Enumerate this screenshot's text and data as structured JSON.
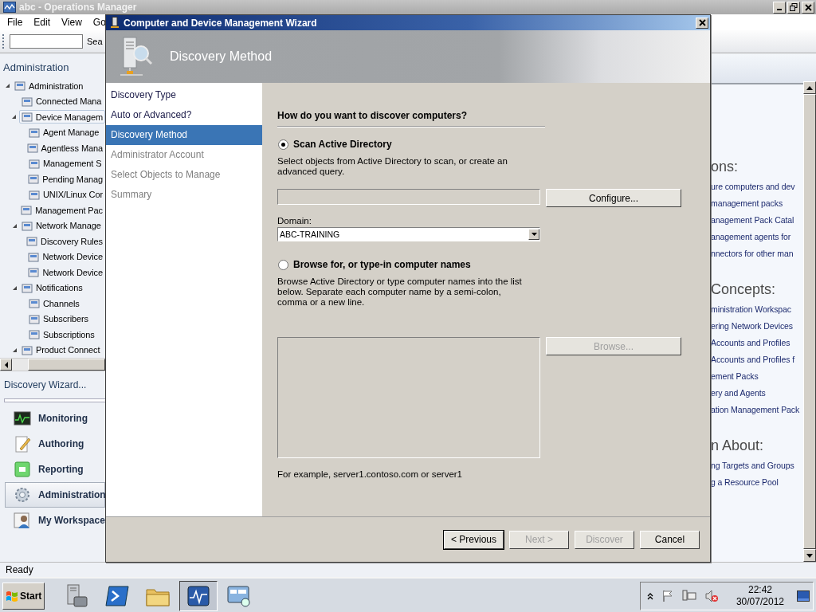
{
  "main_window": {
    "title": "abc - Operations Manager",
    "menu": [
      "File",
      "Edit",
      "View",
      "Go"
    ],
    "search_button": "Sea"
  },
  "navigation": {
    "heading": "Administration",
    "tree": [
      {
        "label": "Administration",
        "selected": false,
        "expanded": true,
        "children": [
          {
            "label": "Connected Mana",
            "selected": false
          },
          {
            "label": "Device Managem",
            "selected": true,
            "expanded": true,
            "children": [
              {
                "label": "Agent Manage",
                "selected": false
              },
              {
                "label": "Agentless Mana",
                "selected": false
              },
              {
                "label": "Management S",
                "selected": false
              },
              {
                "label": "Pending Manag",
                "selected": false
              },
              {
                "label": "UNIX/Linux Cor",
                "selected": false
              }
            ]
          },
          {
            "label": "Management Pac",
            "selected": false
          },
          {
            "label": "Network Manage",
            "selected": false,
            "expanded": true,
            "children": [
              {
                "label": "Discovery Rules",
                "selected": false
              },
              {
                "label": "Network Device",
                "selected": false
              },
              {
                "label": "Network Device",
                "selected": false
              }
            ]
          },
          {
            "label": "Notifications",
            "selected": false,
            "expanded": true,
            "children": [
              {
                "label": "Channels",
                "selected": false
              },
              {
                "label": "Subscribers",
                "selected": false
              },
              {
                "label": "Subscriptions",
                "selected": false
              }
            ]
          },
          {
            "label": "Product Connect",
            "selected": false,
            "expanded": true
          }
        ]
      }
    ],
    "tasks": [
      "Discovery Wizard..."
    ],
    "workspaces": [
      {
        "label": "Monitoring",
        "selected": false
      },
      {
        "label": "Authoring",
        "selected": false
      },
      {
        "label": "Reporting",
        "selected": false
      },
      {
        "label": "Administration",
        "selected": true
      },
      {
        "label": "My Workspace",
        "selected": false
      }
    ]
  },
  "help_panel": {
    "sections": [
      {
        "heading": "ons:",
        "links": [
          "ure computers and dev",
          "management packs",
          "anagement Pack Catal",
          "anagement agents for",
          "nnectors for other man"
        ]
      },
      {
        "heading": "Concepts:",
        "links": [
          "ministration Workspac",
          "ering Network Devices",
          "Accounts and Profiles",
          "Accounts and Profiles f",
          "ement Packs",
          "ery and Agents",
          "ation Management Pack"
        ]
      },
      {
        "heading": "n About:",
        "links": [
          "ng Targets and Groups",
          "g a Resource Pool"
        ]
      }
    ]
  },
  "status_bar": "Ready",
  "wizard": {
    "title": "Computer and Device Management Wizard",
    "page_title": "Discovery Method",
    "steps": [
      {
        "label": "Discovery Type",
        "selected": false,
        "visited": true
      },
      {
        "label": "Auto or Advanced?",
        "selected": false,
        "visited": true
      },
      {
        "label": "Discovery Method",
        "selected": true,
        "visited": true
      },
      {
        "label": "Administrator Account",
        "selected": false,
        "visited": false
      },
      {
        "label": "Select Objects to Manage",
        "selected": false,
        "visited": false
      },
      {
        "label": "Summary",
        "selected": false,
        "visited": false
      }
    ],
    "question": "How do you want to discover computers?",
    "options": [
      {
        "label": "Scan Active Directory",
        "selected": true,
        "description": "Select objects from Active Directory to scan, or create an advanced query."
      },
      {
        "label": "Browse for, or type-in computer names",
        "selected": false,
        "description": "Browse Active Directory or type computer names into the list below. Separate each computer name by a semi-colon, comma or a new line."
      }
    ],
    "query_field": {
      "disabled": true
    },
    "configure_button": {
      "label": "Configure...",
      "disabled": false
    },
    "domain": {
      "label": "Domain:",
      "value": "ABC-TRAINING"
    },
    "names_box": {
      "disabled": true
    },
    "browse_button": {
      "label": "Browse...",
      "disabled": true
    },
    "example": "For example, server1.contoso.com or server1",
    "buttons": [
      {
        "label": "< Previous",
        "disabled": false,
        "default": true
      },
      {
        "label": "Next >",
        "disabled": true,
        "default": false
      },
      {
        "label": "Discover",
        "disabled": true,
        "default": false
      },
      {
        "label": "Cancel",
        "disabled": false,
        "default": false
      }
    ]
  },
  "taskbar": {
    "start": "Start",
    "apps": [
      {
        "active": false
      },
      {
        "active": false
      },
      {
        "active": false
      },
      {
        "active": true
      },
      {
        "active": false
      }
    ],
    "tray": {
      "muted": true,
      "time": "22:42",
      "date": "30/07/2012"
    }
  }
}
